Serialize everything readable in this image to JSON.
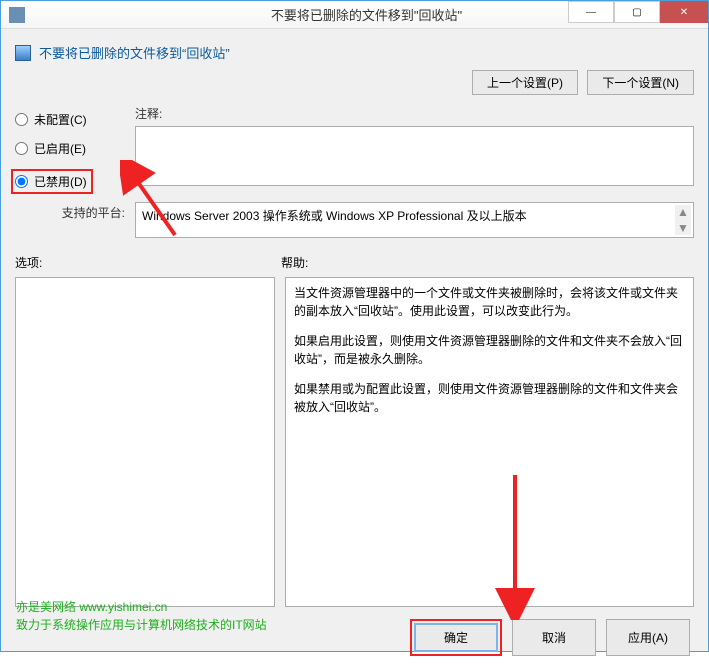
{
  "window": {
    "title": "不要将已删除的文件移到\"回收站\"",
    "minimize": "—",
    "maximize": "▢",
    "close": "✕"
  },
  "header": {
    "title": "不要将已删除的文件移到“回收站”",
    "prev_button": "上一个设置(P)",
    "next_button": "下一个设置(N)"
  },
  "radios": {
    "not_configured": "未配置(C)",
    "enabled": "已启用(E)",
    "disabled": "已禁用(D)",
    "selected": "disabled"
  },
  "fields": {
    "comment_label": "注释:",
    "comment_value": "",
    "platform_label": "支持的平台:",
    "platform_value": "Windows Server 2003 操作系统或 Windows XP Professional 及以上版本"
  },
  "sections": {
    "options_label": "选项:",
    "help_label": "帮助:"
  },
  "help": {
    "p1": "当文件资源管理器中的一个文件或文件夹被删除时，会将该文件或文件夹的副本放入“回收站”。使用此设置，可以改变此行为。",
    "p2": "如果启用此设置，则使用文件资源管理器删除的文件和文件夹不会放入“回收站”，而是被永久删除。",
    "p3": "如果禁用或为配置此设置，则使用文件资源管理器删除的文件和文件夹会被放入“回收站”。"
  },
  "footer": {
    "ok": "确定",
    "cancel": "取消",
    "apply": "应用(A)"
  },
  "watermark": {
    "line1": "亦是美网络 www.yishimei.cn",
    "line2": "致力于系统操作应用与计算机网络技术的IT网站"
  }
}
